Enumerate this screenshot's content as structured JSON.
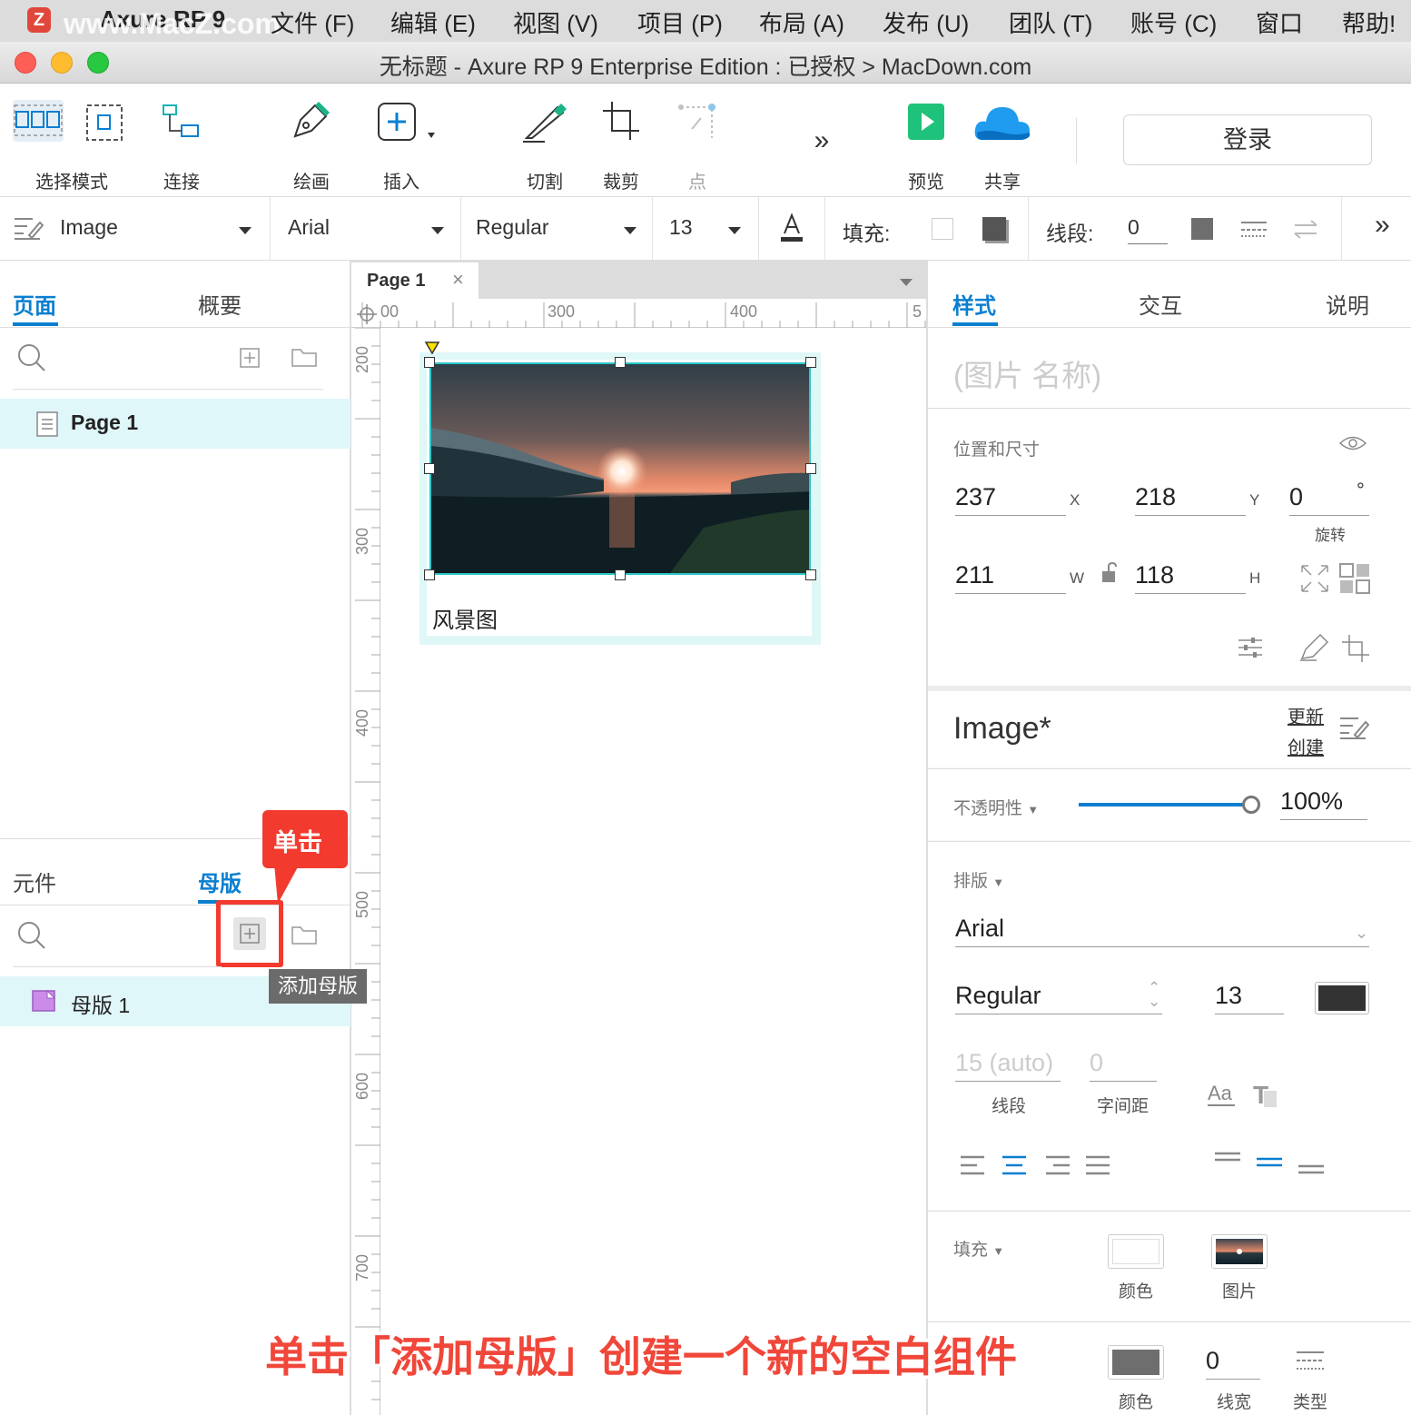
{
  "menubar": {
    "watermark": "www.MacZ.com",
    "app_name": "Axure RP 9",
    "items": [
      "文件 (F)",
      "编辑 (E)",
      "视图 (V)",
      "项目 (P)",
      "布局 (A)",
      "发布 (U)",
      "团队 (T)",
      "账号 (C)",
      "窗口",
      "帮助!"
    ]
  },
  "window": {
    "title": "无标题 - Axure RP 9 Enterprise Edition : 已授权 > MacDown.com"
  },
  "toolbar": {
    "select_mode": "选择模式",
    "connect": "连接",
    "draw": "绘画",
    "insert": "插入",
    "slice": "切割",
    "crop": "裁剪",
    "point": "点",
    "preview": "预览",
    "share": "共享",
    "login": "登录"
  },
  "format_bar": {
    "widget_style": "Image",
    "font_family": "Arial",
    "font_weight": "Regular",
    "font_size": "13",
    "fill_label": "填充:",
    "stroke_label": "线段:",
    "stroke_value": "0"
  },
  "left_pane": {
    "tabs": [
      "页面",
      "概要"
    ],
    "pages": [
      "Page 1"
    ],
    "lib_tabs": [
      "元件",
      "母版"
    ],
    "masters": [
      "母版 1"
    ],
    "add_master_tooltip": "添加母版",
    "callout": "单击"
  },
  "canvas": {
    "tab_label": "Page 1",
    "h_ruler": [
      "00",
      "300",
      "400",
      "5"
    ],
    "v_ruler": [
      "200",
      "300",
      "400",
      "500",
      "600",
      "700"
    ],
    "image_caption": "风景图"
  },
  "right_pane": {
    "tabs": [
      "样式",
      "交互",
      "说明"
    ],
    "name_placeholder": "(图片 名称)",
    "pos_size_title": "位置和尺寸",
    "x": "237",
    "x_label": "X",
    "y": "218",
    "y_label": "Y",
    "rotation": "0",
    "rotation_unit": "°",
    "rotation_label": "旋转",
    "w": "211",
    "w_label": "W",
    "h": "118",
    "h_label": "H",
    "style_name": "Image*",
    "style_update": "更新",
    "style_create": "创建",
    "opacity_label": "不透明性",
    "opacity": 1.0,
    "opacity_text": "100%",
    "typography_label": "排版",
    "font": "Arial",
    "weight": "Regular",
    "size": "13",
    "line_height": "15 (auto)",
    "line_height_label": "线段",
    "letter_spacing": "0",
    "letter_spacing_label": "字间距",
    "fill_label": "填充",
    "fill_color_label": "颜色",
    "fill_image_label": "图片",
    "border_color_label": "颜色",
    "border_width": "0",
    "border_width_label": "线宽",
    "border_type_label": "类型"
  },
  "annotation_caption": "单击「添加母版」创建一个新的空白组件",
  "colors": {
    "accent": "#0a7fd0",
    "callout_red": "#f23b2e",
    "selection_cyan": "#29c7c7",
    "preview_green": "#1fc27a",
    "share_blue": "#1f9bf0"
  }
}
